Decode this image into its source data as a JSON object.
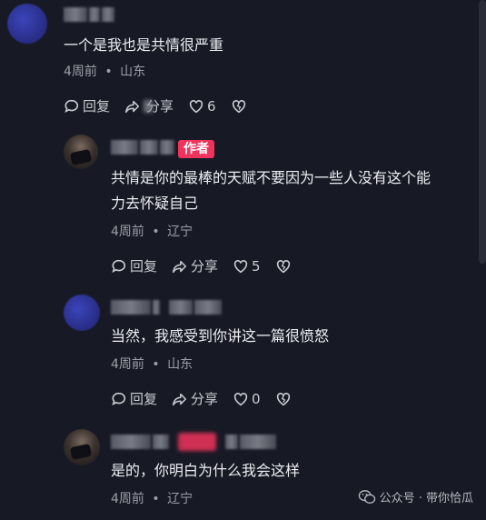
{
  "comments": [
    {
      "text": "一个是我也是共情很严重",
      "time": "4周前",
      "location": "山东",
      "reply_label": "回复",
      "share_label": "分享",
      "like_count": "6"
    },
    {
      "badge": "作者",
      "text_line1": "共情是你的最棒的天赋不要因为一些人没有这个能",
      "text_line2": "力去怀疑自己",
      "time": "4周前",
      "location": "辽宁",
      "reply_label": "回复",
      "share_label": "分享",
      "like_count": "5"
    },
    {
      "text": "当然，我感受到你讲这一篇很愤怒",
      "time": "4周前",
      "location": "山东",
      "reply_label": "回复",
      "share_label": "分享",
      "like_count": "0"
    },
    {
      "text": "是的，你明白为什么我会这样",
      "time": "4周前",
      "location": "辽宁"
    }
  ],
  "meta_separator": "•",
  "watermark": {
    "text": "公众号 · 带你恰瓜",
    "icon": "wechat-icon"
  },
  "colors": {
    "background": "#171a24",
    "author_badge": "#f0335c",
    "muted_text": "#9c9fa8"
  }
}
